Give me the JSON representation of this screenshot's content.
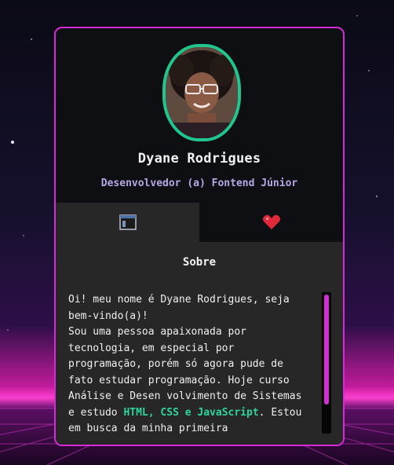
{
  "profile": {
    "name": "Dyane Rodrigues",
    "role": "Desenvolvedor (a) Fontend Júnior"
  },
  "tabs": [
    {
      "icon": "browser-window-icon",
      "active": true
    },
    {
      "icon": "heart-icon",
      "active": false
    }
  ],
  "about": {
    "title": "Sobre",
    "bio_lines": [
      "Oi! meu nome é Dyane Rodrigues, seja",
      "bem-vindo(a)!",
      "Sou uma pessoa apaixonada por",
      "tecnologia, em especial por",
      "programação, porém só agora pude de",
      "fato estudar programação. Hoje curso",
      "Análise e Desen volvimento de Sistemas"
    ],
    "bio_line8_start": "e estudo ",
    "tech_html": "HTML,",
    "tech_space1": " ",
    "tech_css": "CSS",
    "tech_e": " e ",
    "tech_js": "JavaScript",
    "bio_line8_end": ". Estou",
    "bio_line9": "em busca da minha primeira"
  },
  "colors": {
    "accent_border": "#d62ad6",
    "avatar_ring": "#1fc78e",
    "role_text": "#b8a7e6",
    "tech_highlight": "#2ed49c",
    "scroll_thumb": "#d32ed3"
  }
}
